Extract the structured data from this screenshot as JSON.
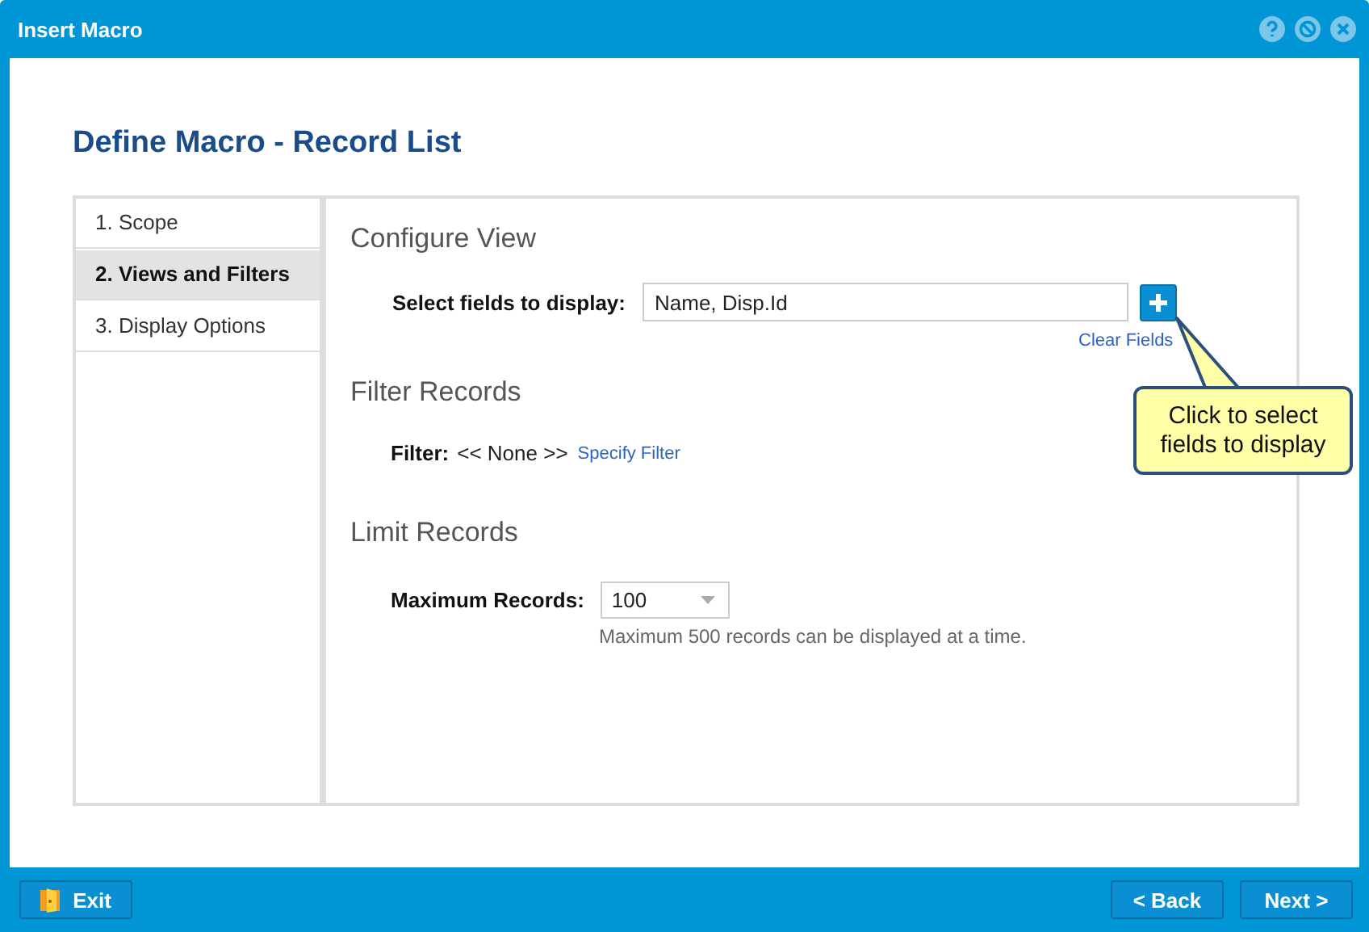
{
  "window": {
    "title": "Insert Macro"
  },
  "heading": "Define Macro - Record List",
  "steps": [
    {
      "label": "1. Scope",
      "selected": false
    },
    {
      "label": "2. Views and Filters",
      "selected": true
    },
    {
      "label": "3. Display Options",
      "selected": false
    }
  ],
  "configure_view": {
    "title": "Configure View",
    "label": "Select fields to display:",
    "value": "Name, Disp.Id",
    "clear_link": "Clear Fields"
  },
  "filter_records": {
    "title": "Filter Records",
    "label": "Filter:",
    "value": "<< None >>",
    "link": "Specify Filter"
  },
  "limit_records": {
    "title": "Limit Records",
    "label": "Maximum Records:",
    "value": "100",
    "hint": "Maximum 500 records can be displayed at a time."
  },
  "callout": "Click to select fields to display",
  "footer": {
    "exit": "Exit",
    "back": "< Back",
    "next": "Next >"
  }
}
